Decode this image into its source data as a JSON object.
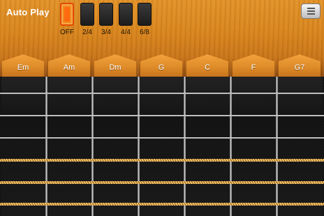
{
  "header": {
    "title": "Auto Play",
    "menu_icon": "menu-icon"
  },
  "rhythm": {
    "selected": "OFF",
    "options": [
      {
        "label": "OFF"
      },
      {
        "label": "2/4"
      },
      {
        "label": "3/4"
      },
      {
        "label": "4/4"
      },
      {
        "label": "6/8"
      }
    ]
  },
  "chords": [
    "Em",
    "Am",
    "Dm",
    "G",
    "C",
    "F",
    "G7"
  ],
  "strings": {
    "count": 6,
    "plain": 3,
    "wound": 3
  },
  "colors": {
    "wood": "#d9861f",
    "accent": "#ff6a10",
    "fretboard": "#141414",
    "wound_string": "#f3c26a"
  }
}
